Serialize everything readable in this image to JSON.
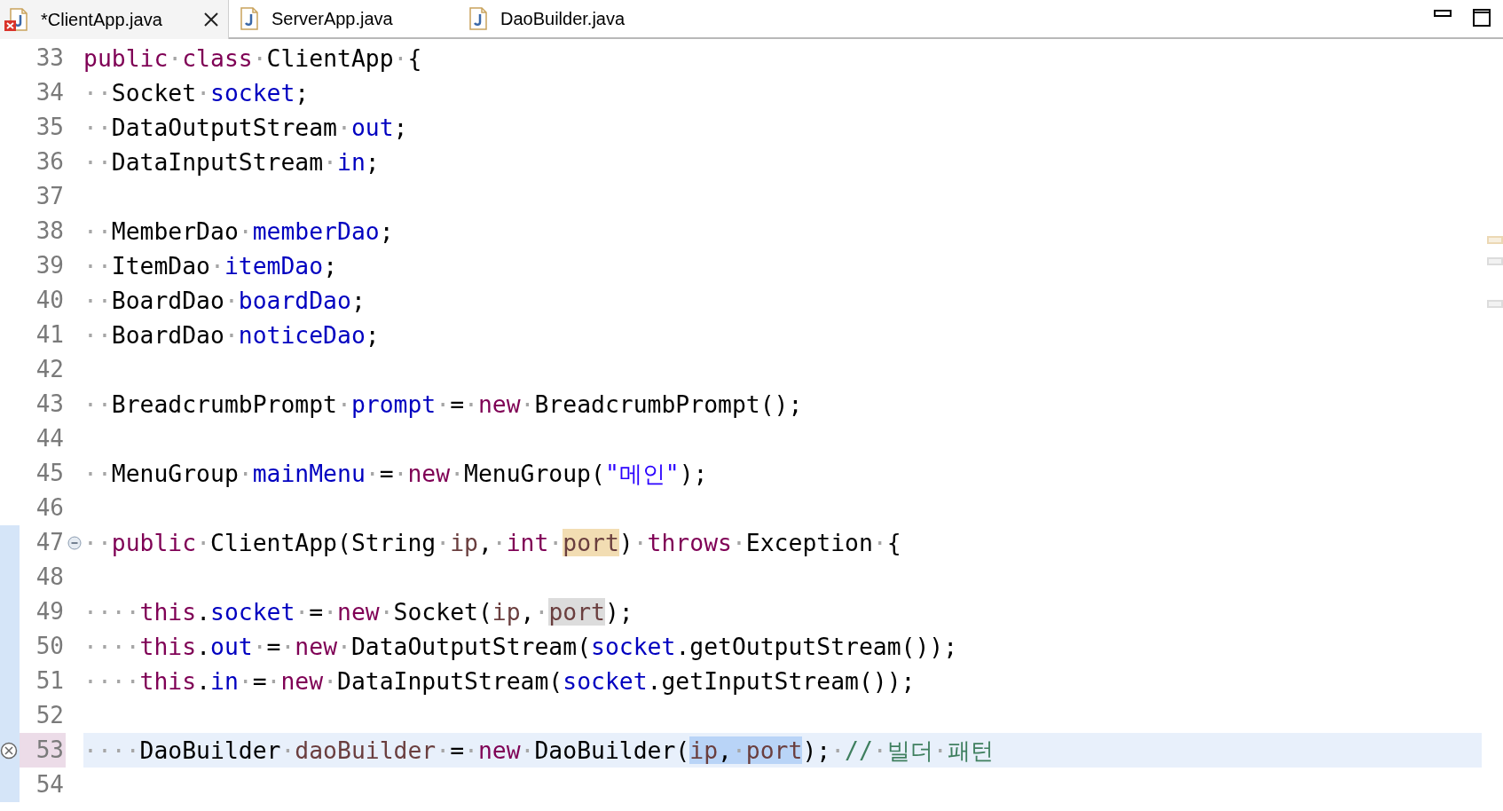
{
  "tabs": [
    {
      "label": "*ClientApp.java",
      "selected": true,
      "error": true
    },
    {
      "label": "ServerApp.java",
      "selected": false,
      "error": false
    },
    {
      "label": "DaoBuilder.java",
      "selected": false,
      "error": false
    }
  ],
  "lines": [
    {
      "number": "33",
      "changed": false,
      "tokens": [
        {
          "text": "public",
          "kind": "keyword"
        },
        {
          "text": "·",
          "kind": "space"
        },
        {
          "text": "class",
          "kind": "keyword"
        },
        {
          "text": "·",
          "kind": "space"
        },
        {
          "text": "ClientApp",
          "kind": "plain"
        },
        {
          "text": "·",
          "kind": "space"
        },
        {
          "text": "{",
          "kind": "plain"
        }
      ]
    },
    {
      "number": "34",
      "changed": false,
      "tokens": [
        {
          "text": "··",
          "kind": "space"
        },
        {
          "text": "Socket",
          "kind": "plain"
        },
        {
          "text": "·",
          "kind": "space"
        },
        {
          "text": "socket",
          "kind": "field"
        },
        {
          "text": ";",
          "kind": "plain"
        }
      ]
    },
    {
      "number": "35",
      "changed": false,
      "tokens": [
        {
          "text": "··",
          "kind": "space"
        },
        {
          "text": "DataOutputStream",
          "kind": "plain"
        },
        {
          "text": "·",
          "kind": "space"
        },
        {
          "text": "out",
          "kind": "field"
        },
        {
          "text": ";",
          "kind": "plain"
        }
      ]
    },
    {
      "number": "36",
      "changed": false,
      "tokens": [
        {
          "text": "··",
          "kind": "space"
        },
        {
          "text": "DataInputStream",
          "kind": "plain"
        },
        {
          "text": "·",
          "kind": "space"
        },
        {
          "text": "in",
          "kind": "field"
        },
        {
          "text": ";",
          "kind": "plain"
        }
      ]
    },
    {
      "number": "37",
      "changed": false
    },
    {
      "number": "38",
      "changed": false,
      "tokens": [
        {
          "text": "··",
          "kind": "space"
        },
        {
          "text": "MemberDao",
          "kind": "plain"
        },
        {
          "text": "·",
          "kind": "space"
        },
        {
          "text": "memberDao",
          "kind": "field"
        },
        {
          "text": ";",
          "kind": "plain"
        }
      ]
    },
    {
      "number": "39",
      "changed": false,
      "tokens": [
        {
          "text": "··",
          "kind": "space"
        },
        {
          "text": "ItemDao",
          "kind": "plain"
        },
        {
          "text": "·",
          "kind": "space"
        },
        {
          "text": "itemDao",
          "kind": "field"
        },
        {
          "text": ";",
          "kind": "plain"
        }
      ]
    },
    {
      "number": "40",
      "changed": false,
      "tokens": [
        {
          "text": "··",
          "kind": "space"
        },
        {
          "text": "BoardDao",
          "kind": "plain"
        },
        {
          "text": "·",
          "kind": "space"
        },
        {
          "text": "boardDao",
          "kind": "field"
        },
        {
          "text": ";",
          "kind": "plain"
        }
      ]
    },
    {
      "number": "41",
      "changed": false,
      "tokens": [
        {
          "text": "··",
          "kind": "space"
        },
        {
          "text": "BoardDao",
          "kind": "plain"
        },
        {
          "text": "·",
          "kind": "space"
        },
        {
          "text": "noticeDao",
          "kind": "field"
        },
        {
          "text": ";",
          "kind": "plain"
        }
      ]
    },
    {
      "number": "42",
      "changed": false
    },
    {
      "number": "43",
      "changed": false,
      "tokens": [
        {
          "text": "··",
          "kind": "space"
        },
        {
          "text": "BreadcrumbPrompt",
          "kind": "plain"
        },
        {
          "text": "·",
          "kind": "space"
        },
        {
          "text": "prompt",
          "kind": "field"
        },
        {
          "text": "·",
          "kind": "space"
        },
        {
          "text": "=",
          "kind": "plain"
        },
        {
          "text": "·",
          "kind": "space"
        },
        {
          "text": "new",
          "kind": "keyword"
        },
        {
          "text": "·",
          "kind": "space"
        },
        {
          "text": "BreadcrumbPrompt();",
          "kind": "plain"
        }
      ]
    },
    {
      "number": "44",
      "changed": false
    },
    {
      "number": "45",
      "changed": false,
      "tokens": [
        {
          "text": "··",
          "kind": "space"
        },
        {
          "text": "MenuGroup",
          "kind": "plain"
        },
        {
          "text": "·",
          "kind": "space"
        },
        {
          "text": "mainMenu",
          "kind": "field"
        },
        {
          "text": "·",
          "kind": "space"
        },
        {
          "text": "=",
          "kind": "plain"
        },
        {
          "text": "·",
          "kind": "space"
        },
        {
          "text": "new",
          "kind": "keyword"
        },
        {
          "text": "·",
          "kind": "space"
        },
        {
          "text": "MenuGroup(",
          "kind": "plain"
        },
        {
          "text": "\"메인\"",
          "kind": "string"
        },
        {
          "text": ");",
          "kind": "plain"
        }
      ]
    },
    {
      "number": "46",
      "changed": false
    },
    {
      "number": "47",
      "changed": true,
      "fold_expanded": true,
      "tokens": [
        {
          "text": "··",
          "kind": "space"
        },
        {
          "text": "public",
          "kind": "keyword"
        },
        {
          "text": "·",
          "kind": "space"
        },
        {
          "text": "ClientApp(String",
          "kind": "plain"
        },
        {
          "text": "·",
          "kind": "space"
        },
        {
          "text": "ip",
          "kind": "local"
        },
        {
          "text": ",",
          "kind": "plain"
        },
        {
          "text": "·",
          "kind": "space"
        },
        {
          "text": "int",
          "kind": "keyword"
        },
        {
          "text": "·",
          "kind": "space"
        },
        {
          "text": "port",
          "kind": "local",
          "write_occurrence": true
        },
        {
          "text": ")",
          "kind": "plain"
        },
        {
          "text": "·",
          "kind": "space"
        },
        {
          "text": "throws",
          "kind": "keyword"
        },
        {
          "text": "·",
          "kind": "space"
        },
        {
          "text": "Exception",
          "kind": "plain"
        },
        {
          "text": "·",
          "kind": "space"
        },
        {
          "text": "{",
          "kind": "plain"
        }
      ]
    },
    {
      "number": "48",
      "changed": true
    },
    {
      "number": "49",
      "changed": true,
      "tokens": [
        {
          "text": "····",
          "kind": "space"
        },
        {
          "text": "this",
          "kind": "keyword"
        },
        {
          "text": ".",
          "kind": "plain"
        },
        {
          "text": "socket",
          "kind": "field"
        },
        {
          "text": "·",
          "kind": "space"
        },
        {
          "text": "=",
          "kind": "plain"
        },
        {
          "text": "·",
          "kind": "space"
        },
        {
          "text": "new",
          "kind": "keyword"
        },
        {
          "text": "·",
          "kind": "space"
        },
        {
          "text": "Socket(",
          "kind": "plain"
        },
        {
          "text": "ip",
          "kind": "local"
        },
        {
          "text": ",",
          "kind": "plain"
        },
        {
          "text": "·",
          "kind": "space"
        },
        {
          "text": "port",
          "kind": "local",
          "read_occurrence": true
        },
        {
          "text": ");",
          "kind": "plain"
        }
      ]
    },
    {
      "number": "50",
      "changed": true,
      "tokens": [
        {
          "text": "····",
          "kind": "space"
        },
        {
          "text": "this",
          "kind": "keyword"
        },
        {
          "text": ".",
          "kind": "plain"
        },
        {
          "text": "out",
          "kind": "field"
        },
        {
          "text": "·",
          "kind": "space"
        },
        {
          "text": "=",
          "kind": "plain"
        },
        {
          "text": "·",
          "kind": "space"
        },
        {
          "text": "new",
          "kind": "keyword"
        },
        {
          "text": "·",
          "kind": "space"
        },
        {
          "text": "DataOutputStream(",
          "kind": "plain"
        },
        {
          "text": "socket",
          "kind": "field"
        },
        {
          "text": ".getOutputStream());",
          "kind": "plain"
        }
      ]
    },
    {
      "number": "51",
      "changed": true,
      "tokens": [
        {
          "text": "····",
          "kind": "space"
        },
        {
          "text": "this",
          "kind": "keyword"
        },
        {
          "text": ".",
          "kind": "plain"
        },
        {
          "text": "in",
          "kind": "field"
        },
        {
          "text": "·",
          "kind": "space"
        },
        {
          "text": "=",
          "kind": "plain"
        },
        {
          "text": "·",
          "kind": "space"
        },
        {
          "text": "new",
          "kind": "keyword"
        },
        {
          "text": "·",
          "kind": "space"
        },
        {
          "text": "DataInputStream(",
          "kind": "plain"
        },
        {
          "text": "socket",
          "kind": "field"
        },
        {
          "text": ".getInputStream());",
          "kind": "plain"
        }
      ]
    },
    {
      "number": "52",
      "changed": true
    },
    {
      "number": "53",
      "changed": true,
      "current": true,
      "error": true,
      "tokens": [
        {
          "text": "····",
          "kind": "space"
        },
        {
          "text": "DaoBuilder",
          "kind": "plain"
        },
        {
          "text": "·",
          "kind": "space"
        },
        {
          "text": "daoBuilder",
          "kind": "local"
        },
        {
          "text": "·",
          "kind": "space"
        },
        {
          "text": "=",
          "kind": "plain"
        },
        {
          "text": "·",
          "kind": "space"
        },
        {
          "text": "new",
          "kind": "keyword"
        },
        {
          "text": "·",
          "kind": "space"
        },
        {
          "text": "DaoBuilder(",
          "kind": "plain"
        },
        {
          "text": "ip",
          "kind": "local",
          "selected": true
        },
        {
          "text": ",",
          "kind": "plain",
          "selected": true
        },
        {
          "text": "·",
          "kind": "space",
          "selected": true
        },
        {
          "text": "port",
          "kind": "local",
          "selected": true
        },
        {
          "text": ");",
          "kind": "plain"
        },
        {
          "text": "·",
          "kind": "space"
        },
        {
          "text": "//",
          "kind": "comment"
        },
        {
          "text": "·",
          "kind": "space"
        },
        {
          "text": "빌더",
          "kind": "comment"
        },
        {
          "text": "·",
          "kind": "space"
        },
        {
          "text": "패턴",
          "kind": "comment"
        }
      ]
    },
    {
      "number": "54",
      "changed": true
    }
  ]
}
